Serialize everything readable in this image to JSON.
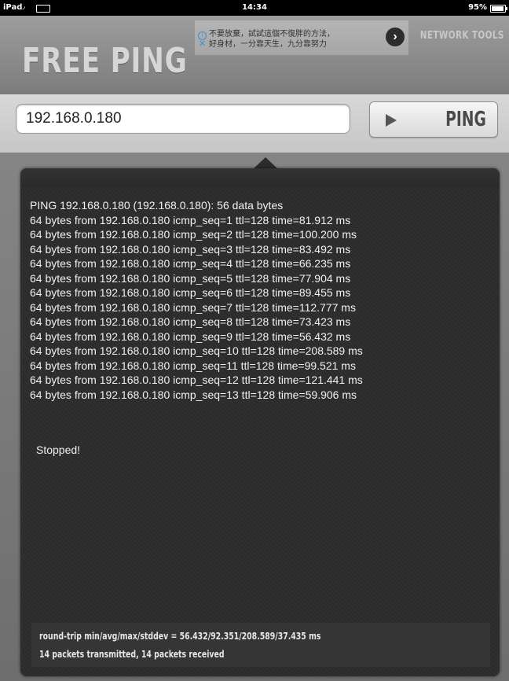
{
  "status_bar": {
    "carrier": "iPad",
    "wifi": "wifi",
    "time": "14:34",
    "battery": "95%"
  },
  "header": {
    "app_title": "FREE PING",
    "network_tools_label": "NETWORK TOOLS"
  },
  "ad": {
    "line1": "不要放棄，試試這個不復胖的方法，",
    "line2": "好身材，一分靠天生，九分靠努力",
    "arrow": "›"
  },
  "input": {
    "host_value": "192.168.0.180"
  },
  "ping_button": {
    "label": "PING"
  },
  "output": {
    "header_line": "PING 192.168.0.180 (192.168.0.180): 56 data bytes",
    "replies": [
      "64 bytes from 192.168.0.180 icmp_seq=1 ttl=128 time=81.912 ms",
      "64 bytes from 192.168.0.180 icmp_seq=2 ttl=128 time=100.200 ms",
      "64 bytes from 192.168.0.180 icmp_seq=3 ttl=128 time=83.492 ms",
      "64 bytes from 192.168.0.180 icmp_seq=4 ttl=128 time=66.235 ms",
      "64 bytes from 192.168.0.180 icmp_seq=5 ttl=128 time=77.904 ms",
      "64 bytes from 192.168.0.180 icmp_seq=6 ttl=128 time=89.455 ms",
      "64 bytes from 192.168.0.180 icmp_seq=7 ttl=128 time=112.777 ms",
      "64 bytes from 192.168.0.180 icmp_seq=8 ttl=128 time=73.423 ms",
      "64 bytes from 192.168.0.180 icmp_seq=9 ttl=128 time=56.432 ms",
      "64 bytes from 192.168.0.180 icmp_seq=10 ttl=128 time=208.589 ms",
      "64 bytes from 192.168.0.180 icmp_seq=11 ttl=128 time=99.521 ms",
      "64 bytes from 192.168.0.180 icmp_seq=12 ttl=128 time=121.441 ms",
      "64 bytes from 192.168.0.180 icmp_seq=13 ttl=128 time=59.906 ms"
    ],
    "status": "Stopped!",
    "stats_round_trip": "round-trip min/avg/max/stddev = 56.432/92.351/208.589/37.435 ms",
    "stats_packets": "14 packets transmitted, 14 packets received"
  }
}
